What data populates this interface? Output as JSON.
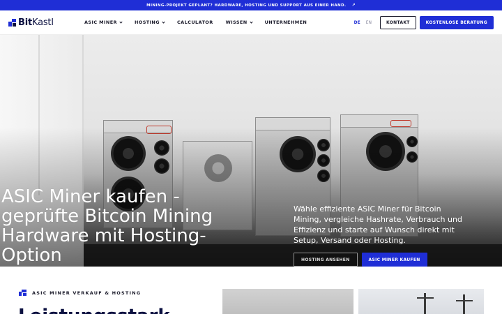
{
  "announcement": {
    "text": "MINING-PROJEKT GEPLANT? HARDWARE, HOSTING UND SUPPORT AUS EINER HAND.",
    "arrow": "↗"
  },
  "brand": {
    "name_bold": "Bit",
    "name_regular": "Kastl"
  },
  "nav": {
    "items": [
      {
        "label": "ASIC MINER",
        "has_dropdown": true
      },
      {
        "label": "HOSTING",
        "has_dropdown": true
      },
      {
        "label": "CALCULATOR",
        "has_dropdown": false
      },
      {
        "label": "WISSEN",
        "has_dropdown": true
      },
      {
        "label": "UNTERNEHMEN",
        "has_dropdown": false
      }
    ]
  },
  "language": {
    "active": "DE",
    "other": "EN"
  },
  "header_buttons": {
    "contact": "KONTAKT",
    "consult": "KOSTENLOSE BERATUNG"
  },
  "hero": {
    "title": "ASIC Miner kaufen - geprüfte Bitcoin Mining Hardware mit Hosting-Option",
    "subtitle": "Wähle effiziente ASIC Miner für Bitcoin Mining, vergleiche Hashrate, Verbrauch und Effizienz und starte auf Wunsch direkt mit Setup, Versand oder Hosting.",
    "button_secondary": "HOSTING ANSEHEN",
    "button_primary": "ASIC MINER KAUFEN",
    "slides": 3,
    "active_slide": 1
  },
  "section": {
    "eyebrow": "ASIC MINER VERKAUF & HOSTING",
    "heading_partial": "Leistungsstark"
  },
  "colors": {
    "accent": "#1f2ed6",
    "navy": "#0b1040",
    "text": "#1a1a2a"
  }
}
